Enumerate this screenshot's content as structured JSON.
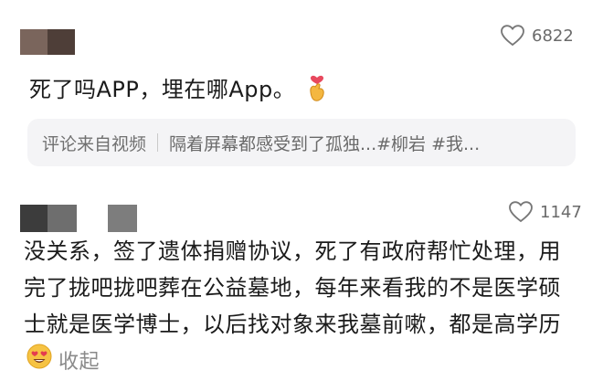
{
  "comment1": {
    "likes": "6822",
    "text": "死了吗APP，埋在哪App。",
    "emoji": "finger-heart-emoji"
  },
  "source_bar": {
    "label": "评论来自视频",
    "video_title": "隔着屏幕都感受到了孤独...#柳岩 #我..."
  },
  "comment2": {
    "likes": "1147",
    "text": "没关系，签了遗体捐赠协议，死了有政府帮忙处理，用完了拢吧拢吧葬在公益墓地，每年来看我的不是医学硕士就是医学博士，以后找对象来我墓前嗽，都是高学历",
    "emoji": "heart-eyes-emoji",
    "collapse_label": "收起"
  },
  "colors": {
    "text": "#1b1b1b",
    "muted": "#707070",
    "source_bg": "#f4f4f6"
  }
}
